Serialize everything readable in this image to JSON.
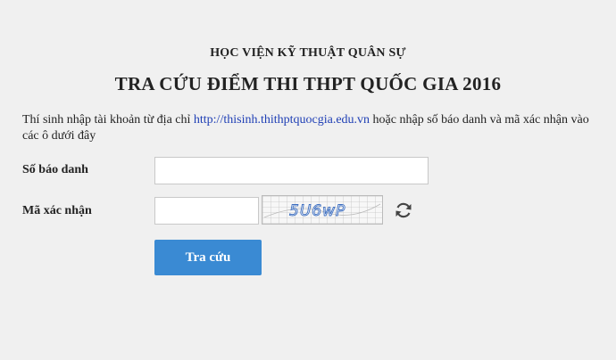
{
  "header": {
    "organization": "HỌC VIỆN KỸ THUẬT QUÂN SỰ",
    "title": "TRA CỨU ĐIỂM THI THPT QUỐC GIA 2016"
  },
  "intro": {
    "text_before": "Thí sinh nhập tài khoản từ địa chỉ ",
    "link": "http://thisinh.thithptquocgia.edu.vn",
    "text_after": " hoặc nhập số báo danh và mã xác nhận vào các ô dưới đây"
  },
  "form": {
    "sbd_label": "Số báo danh",
    "sbd_value": "",
    "captcha_label": "Mã xác nhận",
    "captcha_value": "",
    "captcha_text": "5U6wP",
    "submit_label": "Tra cứu"
  },
  "colors": {
    "button": "#3a8ad3",
    "link": "#1f3fb5",
    "captcha_text": "#3e6fc0"
  },
  "icons": {
    "refresh": "refresh-icon"
  }
}
